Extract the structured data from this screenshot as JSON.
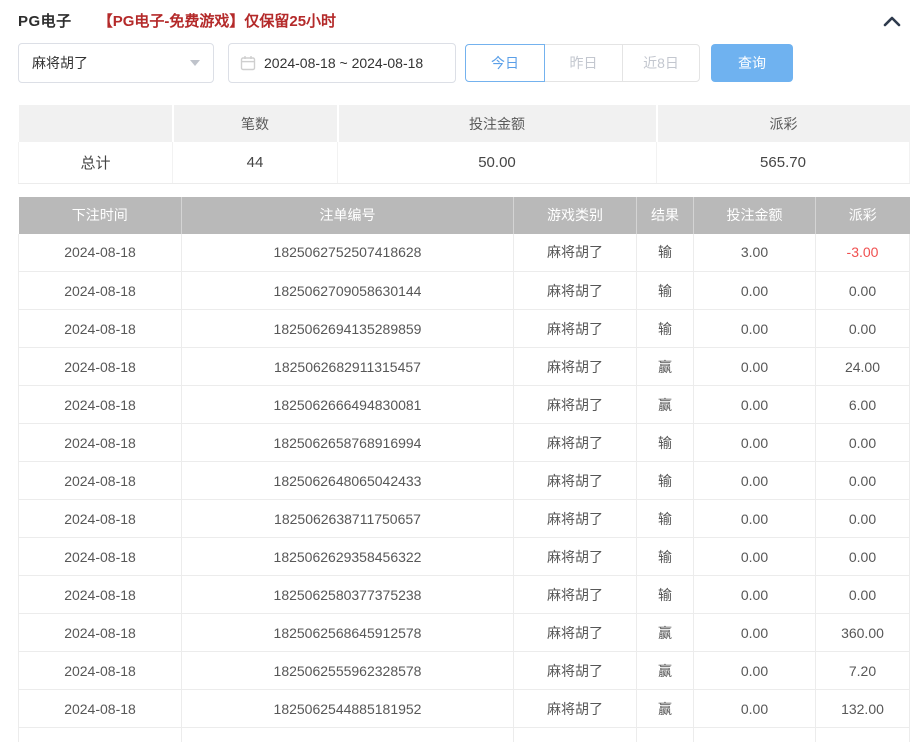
{
  "header": {
    "title": "PG电子",
    "notice": "【PG电子-免费游戏】仅保留25小时"
  },
  "filters": {
    "game_select": {
      "value": "麻将胡了"
    },
    "date_range": {
      "value": "2024-08-18 ~ 2024-08-18"
    },
    "quick_buttons": {
      "today": "今日",
      "yesterday": "昨日",
      "last8days": "近8日"
    },
    "active_quick_button": "今日",
    "search_label": "查询"
  },
  "summary": {
    "columns": {
      "col0": "",
      "col1": "笔数",
      "col2": "投注金额",
      "col3": "派彩"
    },
    "row": {
      "label": "总计",
      "count": "44",
      "bet_amount": "50.00",
      "payout": "565.70"
    }
  },
  "table": {
    "columns": {
      "time": "下注时间",
      "bet_id": "注单编号",
      "game_type": "游戏类别",
      "result": "结果",
      "bet_amount": "投注金额",
      "payout": "派彩"
    },
    "rows": [
      [
        "2024-08-18",
        "1825062752507418628",
        "麻将胡了",
        "输",
        "3.00",
        "-3.00"
      ],
      [
        "2024-08-18",
        "1825062709058630144",
        "麻将胡了",
        "输",
        "0.00",
        "0.00"
      ],
      [
        "2024-08-18",
        "1825062694135289859",
        "麻将胡了",
        "输",
        "0.00",
        "0.00"
      ],
      [
        "2024-08-18",
        "1825062682911315457",
        "麻将胡了",
        "赢",
        "0.00",
        "24.00"
      ],
      [
        "2024-08-18",
        "1825062666494830081",
        "麻将胡了",
        "赢",
        "0.00",
        "6.00"
      ],
      [
        "2024-08-18",
        "1825062658768916994",
        "麻将胡了",
        "输",
        "0.00",
        "0.00"
      ],
      [
        "2024-08-18",
        "1825062648065042433",
        "麻将胡了",
        "输",
        "0.00",
        "0.00"
      ],
      [
        "2024-08-18",
        "1825062638711750657",
        "麻将胡了",
        "输",
        "0.00",
        "0.00"
      ],
      [
        "2024-08-18",
        "1825062629358456322",
        "麻将胡了",
        "输",
        "0.00",
        "0.00"
      ],
      [
        "2024-08-18",
        "1825062580377375238",
        "麻将胡了",
        "输",
        "0.00",
        "0.00"
      ],
      [
        "2024-08-18",
        "1825062568645912578",
        "麻将胡了",
        "赢",
        "0.00",
        "360.00"
      ],
      [
        "2024-08-18",
        "1825062555962328578",
        "麻将胡了",
        "赢",
        "0.00",
        "7.20"
      ],
      [
        "2024-08-18",
        "1825062544885181952",
        "麻将胡了",
        "赢",
        "0.00",
        "132.00"
      ]
    ]
  },
  "colors": {
    "accent_blue": "#6fb2f0",
    "active_tab_blue": "#5a9fe8",
    "negative_red": "#f04f4f",
    "notice_red": "#b42a2a",
    "table_header_gray": "#b9b9b9"
  }
}
